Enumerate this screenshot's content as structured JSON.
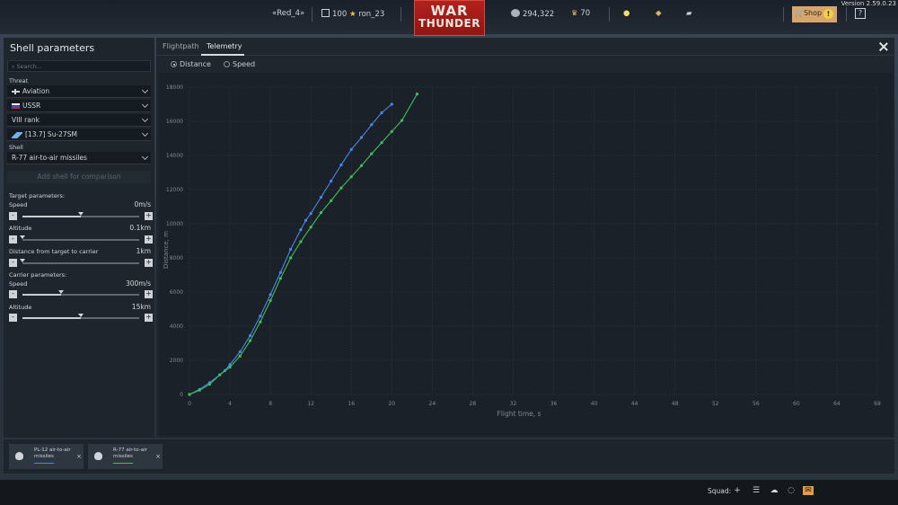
{
  "topbar": {
    "version": "Version 2.59.0.23",
    "squadron_tag": "«Red_4»",
    "player_level": "100",
    "player_name": "ron_23",
    "logo_line1": "WAR",
    "logo_line2": "THUNDER",
    "silver_lions": "294,322",
    "golden_eagles": "70",
    "shop_label": "Shop",
    "shop_badge": "!",
    "help_label": "?"
  },
  "left_panel": {
    "title": "Shell parameters",
    "search_placeholder": "Search...",
    "threat_label": "Threat",
    "threat_value": "Aviation",
    "country_value": "USSR",
    "rank_value": "VIII rank",
    "vehicle_value": "[13.7] Su-27SM",
    "shell_label": "Shell",
    "shell_value": "R-77 air-to-air missiles",
    "compare_button": "Add shell for comparison",
    "target_params_label": "Target parameters:",
    "target_speed": {
      "label": "Speed",
      "value": "0m/s",
      "fraction": 0.5
    },
    "target_altitude": {
      "label": "Altitude",
      "value": "0.1km",
      "fraction": 0.0
    },
    "target_distance": {
      "label": "Distance from target to carrier",
      "value": "1km",
      "fraction": 0.0
    },
    "carrier_params_label": "Carrier parameters:",
    "carrier_speed": {
      "label": "Speed",
      "value": "300m/s",
      "fraction": 0.33
    },
    "carrier_altitude": {
      "label": "Altitude",
      "value": "15km",
      "fraction": 0.5
    }
  },
  "main_panel": {
    "tabs": [
      {
        "label": "Flightpath",
        "active": false
      },
      {
        "label": "Telemetry",
        "active": true
      }
    ],
    "radio_distance": "Distance",
    "radio_speed": "Speed",
    "radio_selected": "Distance"
  },
  "compare_strip": {
    "cards": [
      {
        "name": "PL-12 air-to-air missiles",
        "color": "#4a86e8"
      },
      {
        "name": "R-77 air-to-air missiles",
        "color": "#3fbf5a"
      }
    ],
    "remove_label": "×"
  },
  "bottombar": {
    "squad_label": "Squad:"
  },
  "colors": {
    "accent_red": "#a81b18",
    "series_blue": "#4a86e8",
    "series_green": "#3fbf5a"
  },
  "chart_data": {
    "type": "line",
    "title": "",
    "xlabel": "Flight time, s",
    "ylabel": "Distance, m",
    "xlim": [
      0,
      68
    ],
    "ylim": [
      0,
      18000
    ],
    "xticks": [
      0,
      4,
      8,
      12,
      16,
      20,
      24,
      28,
      32,
      36,
      40,
      44,
      48,
      52,
      56,
      60,
      64,
      68
    ],
    "yticks": [
      0,
      2000,
      4000,
      6000,
      8000,
      10000,
      12000,
      14000,
      16000,
      18000
    ],
    "grid": true,
    "series": [
      {
        "name": "PL-12 air-to-air missiles",
        "color": "#4a86e8",
        "x": [
          0,
          1,
          2,
          3,
          3.5,
          4,
          5,
          6,
          7,
          8,
          9,
          10,
          11,
          11.5,
          12,
          13,
          14,
          15,
          16,
          17,
          18,
          19,
          20
        ],
        "y": [
          0,
          300,
          700,
          1150,
          1400,
          1750,
          2500,
          3450,
          4600,
          5850,
          7150,
          8500,
          9650,
          10200,
          10600,
          11550,
          12500,
          13450,
          14350,
          15050,
          15800,
          16500,
          17000
        ]
      },
      {
        "name": "R-77 air-to-air missiles",
        "color": "#3fbf5a",
        "x": [
          0,
          1,
          2,
          3,
          4,
          5,
          6,
          7,
          8,
          9,
          10,
          11,
          12,
          13,
          14,
          15,
          16,
          17,
          18,
          19,
          20,
          21,
          22.5
        ],
        "y": [
          0,
          250,
          600,
          1150,
          1600,
          2250,
          3150,
          4250,
          5500,
          6800,
          8000,
          8950,
          9800,
          10650,
          11350,
          12100,
          12750,
          13400,
          14100,
          14750,
          15400,
          16050,
          17600
        ]
      }
    ]
  }
}
